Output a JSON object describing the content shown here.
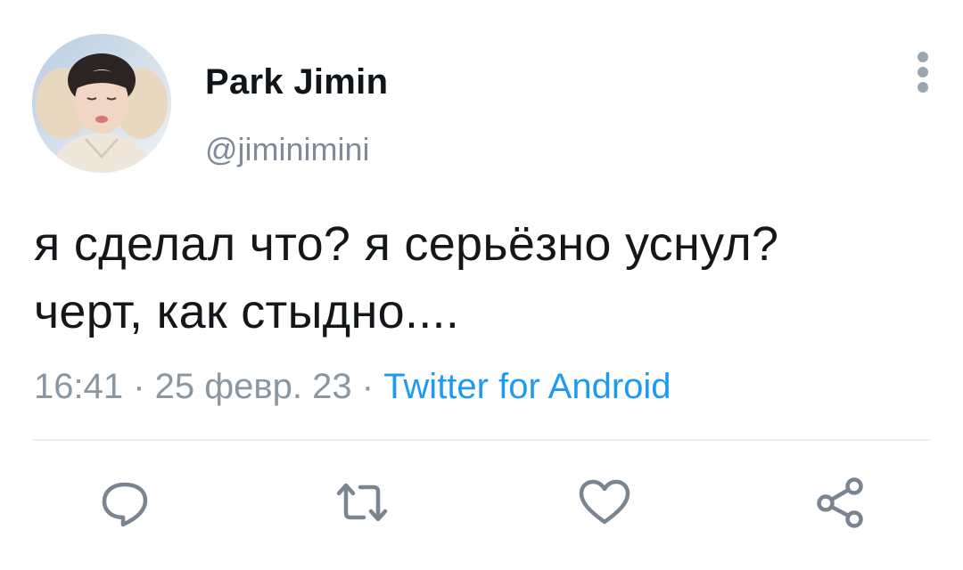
{
  "author": {
    "display_name": "Park Jimin",
    "handle": "@jiminimini",
    "avatar_icon": "profile-photo"
  },
  "tweet": {
    "text_line1": "я сделал что? я серьёзно уснул?",
    "text_line2": "черт, как стыдно....",
    "time": "16:41",
    "separator1": " · ",
    "date": "25 февр. 23",
    "separator2": " · ",
    "source": "Twitter for Android"
  },
  "actions": [
    {
      "icon": "reply-icon"
    },
    {
      "icon": "retweet-icon"
    },
    {
      "icon": "like-icon"
    },
    {
      "icon": "share-icon"
    }
  ],
  "colors": {
    "accent": "#1d9bf0",
    "secondary_text": "#8a96a0",
    "icon_gray": "#7a8591"
  }
}
